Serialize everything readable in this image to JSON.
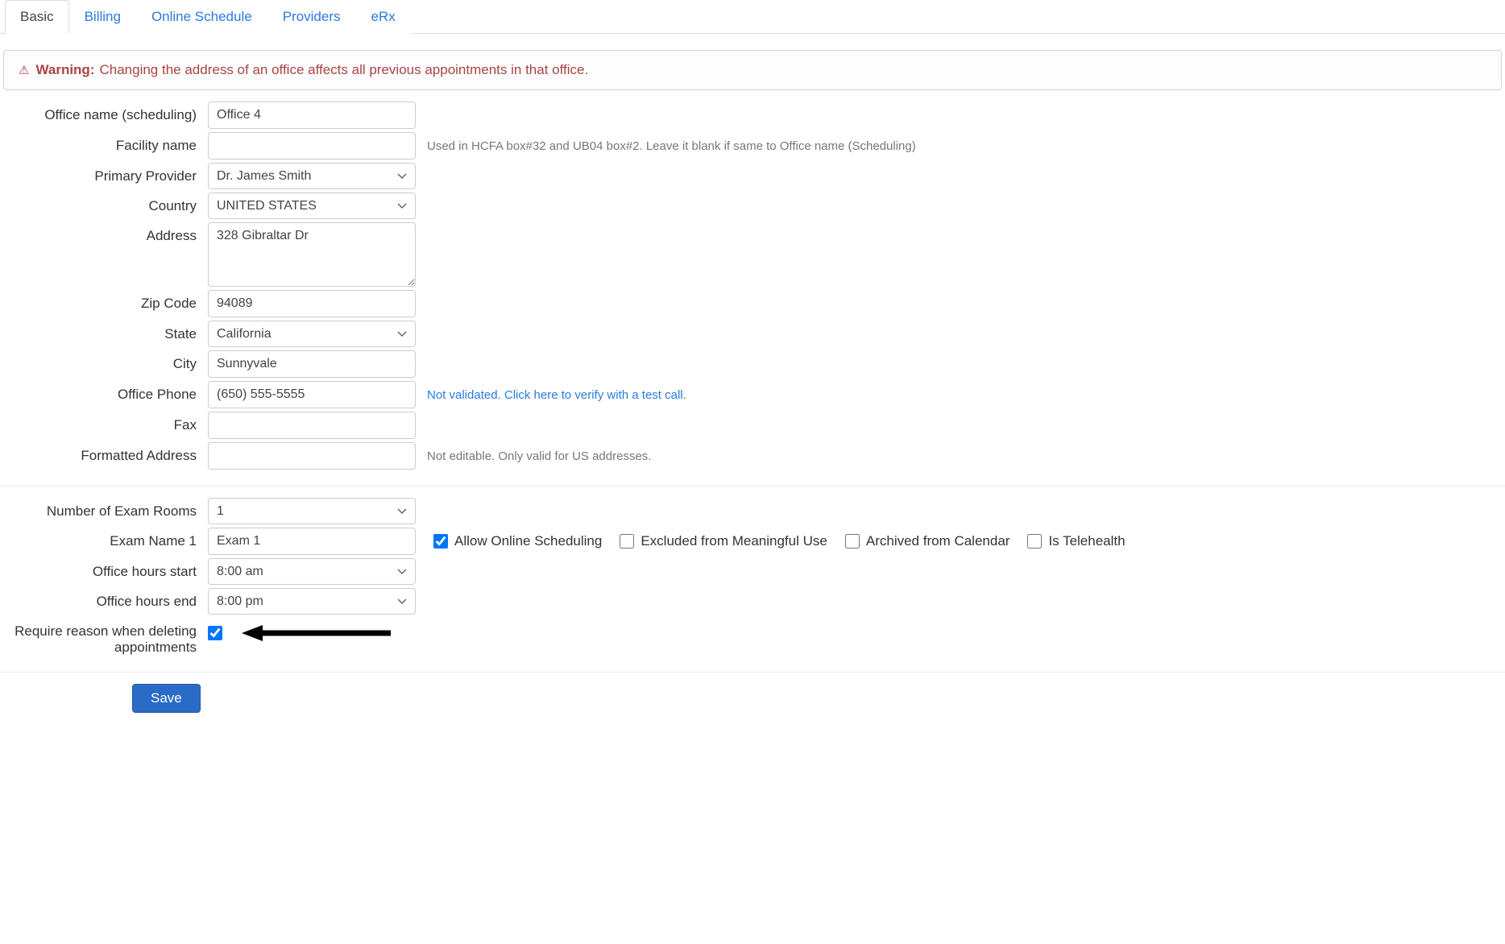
{
  "tabs": {
    "basic": "Basic",
    "billing": "Billing",
    "online_schedule": "Online Schedule",
    "providers": "Providers",
    "erx": "eRx"
  },
  "warning": {
    "prefix": "Warning:",
    "text": "Changing the address of an office affects all previous appointments in that office."
  },
  "labels": {
    "office_name": "Office name (scheduling)",
    "facility_name": "Facility name",
    "primary_provider": "Primary Provider",
    "country": "Country",
    "address": "Address",
    "zip": "Zip Code",
    "state": "State",
    "city": "City",
    "office_phone": "Office Phone",
    "fax": "Fax",
    "formatted_address": "Formatted Address",
    "num_exam_rooms": "Number of Exam Rooms",
    "exam_name_1": "Exam Name 1",
    "office_hours_start": "Office hours start",
    "office_hours_end": "Office hours end",
    "require_reason": "Require reason when deleting appointments"
  },
  "values": {
    "office_name": "Office 4",
    "facility_name": "",
    "primary_provider": "Dr. James Smith",
    "country": "UNITED STATES",
    "address": "328 Gibraltar Dr",
    "zip": "94089",
    "state": "California",
    "city": "Sunnyvale",
    "office_phone": "(650) 555-5555",
    "fax": "",
    "formatted_address": "",
    "num_exam_rooms": "1",
    "exam_name_1": "Exam 1",
    "office_hours_start": "8:00 am",
    "office_hours_end": "8:00 pm"
  },
  "hints": {
    "facility_name": "Used in HCFA box#32 and UB04 box#2. Leave it blank if same to Office name (Scheduling)",
    "phone_validate": "Not validated. Click here to verify with a test call.",
    "formatted_address": "Not editable. Only valid for US addresses."
  },
  "checkboxes": {
    "allow_online": "Allow Online Scheduling",
    "excluded_mu": "Excluded from Meaningful Use",
    "archived": "Archived from Calendar",
    "telehealth": "Is Telehealth"
  },
  "buttons": {
    "save": "Save"
  }
}
